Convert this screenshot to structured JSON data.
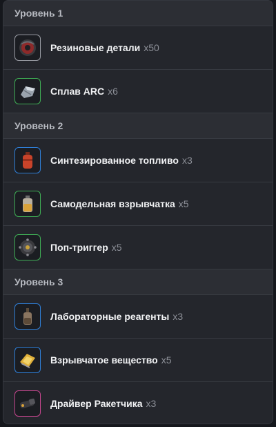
{
  "colors": {
    "rarity_common": "#9a9da4",
    "rarity_uncommon": "#3fae55",
    "rarity_rare": "#2f7fd8",
    "rarity_epic": "#c5468e"
  },
  "levels": [
    {
      "title": "Уровень 1",
      "items": [
        {
          "name": "Резиновые детали",
          "qty": "x50",
          "icon": "rubber-parts-icon",
          "border": "#9a9da4"
        },
        {
          "name": "Сплав ARC",
          "qty": "x6",
          "icon": "arc-alloy-icon",
          "border": "#3fae55"
        }
      ]
    },
    {
      "title": "Уровень 2",
      "items": [
        {
          "name": "Синтезированное топливо",
          "qty": "x3",
          "icon": "synthesized-fuel-icon",
          "border": "#2f7fd8"
        },
        {
          "name": "Самодельная взрывчатка",
          "qty": "x5",
          "icon": "crude-explosives-icon",
          "border": "#3fae55"
        },
        {
          "name": "Поп-триггер",
          "qty": "x5",
          "icon": "pop-trigger-icon",
          "border": "#3fae55"
        }
      ]
    },
    {
      "title": "Уровень 3",
      "items": [
        {
          "name": "Лабораторные реагенты",
          "qty": "x3",
          "icon": "lab-reagents-icon",
          "border": "#2f7fd8"
        },
        {
          "name": "Взрывчатое вещество",
          "qty": "x5",
          "icon": "explosive-compound-icon",
          "border": "#2f7fd8"
        },
        {
          "name": "Драйвер Ракетчика",
          "qty": "x3",
          "icon": "rocketeer-driver-icon",
          "border": "#c5468e"
        }
      ]
    }
  ]
}
